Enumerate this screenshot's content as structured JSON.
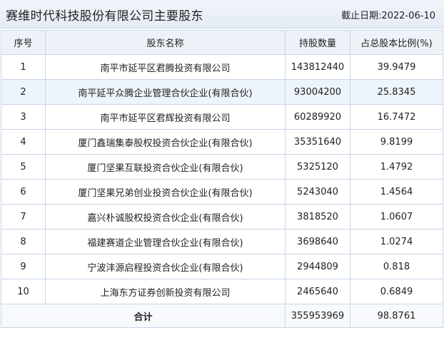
{
  "header": {
    "title": "赛维时代科技股份有限公司主要股东",
    "date": "截止日期:2022-06-10"
  },
  "table": {
    "columns": [
      "序号",
      "股东名称",
      "持股数量",
      "占总股本比例(%)"
    ],
    "rows": [
      [
        "1",
        "南平市延平区君腾投资有限公司",
        "143812440",
        "39.9479"
      ],
      [
        "2",
        "南平延平众腾企业管理合伙企业(有限合伙)",
        "93004200",
        "25.8345"
      ],
      [
        "3",
        "南平市延平区君辉投资有限公司",
        "60289920",
        "16.7472"
      ],
      [
        "4",
        "厦门鑫瑞集泰股权投资合伙企业(有限合伙)",
        "35351640",
        "9.8199"
      ],
      [
        "5",
        "厦门坚果互联投资合伙企业(有限合伙)",
        "5325120",
        "1.4792"
      ],
      [
        "6",
        "厦门坚果兄弟创业投资合伙企业(有限合伙)",
        "5243040",
        "1.4564"
      ],
      [
        "7",
        "嘉兴朴诚股权投资合伙企业(有限合伙)",
        "3818520",
        "1.0607"
      ],
      [
        "8",
        "福建赛道企业管理合伙企业(有限合伙)",
        "3698640",
        "1.0274"
      ],
      [
        "9",
        "宁波沣源启程投资合伙企业(有限合伙)",
        "2944809",
        "0.818"
      ],
      [
        "10",
        "上海东方证券创新投资有限公司",
        "2465640",
        "0.6849"
      ]
    ],
    "total": {
      "label": "合计",
      "shares": "355953969",
      "ratio": "98.8761"
    }
  },
  "colors": {
    "border": "#c7d4e6",
    "header_bg": "#edf2f9",
    "highlight_row_bg": "#edf4fb"
  }
}
